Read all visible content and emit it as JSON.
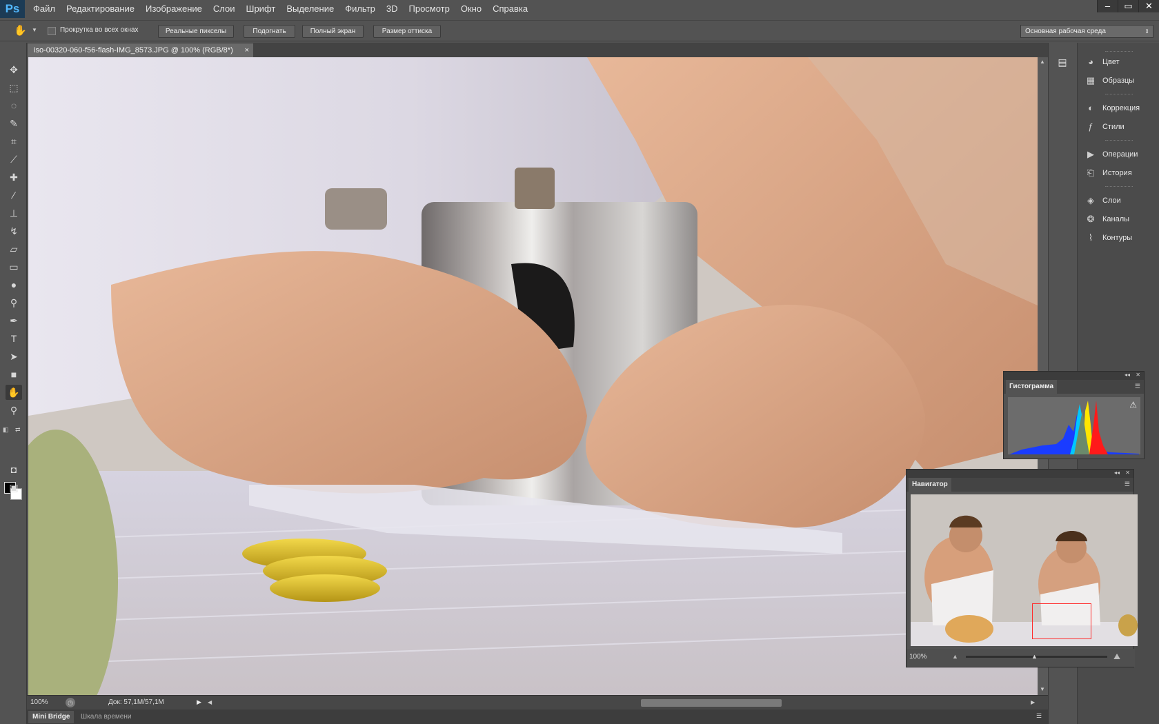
{
  "app": {
    "logo": "Ps"
  },
  "menu": [
    "Файл",
    "Редактирование",
    "Изображение",
    "Слои",
    "Шрифт",
    "Выделение",
    "Фильтр",
    "3D",
    "Просмотр",
    "Окно",
    "Справка"
  ],
  "window_controls": {
    "minimize": "–",
    "restore": "▭",
    "close": "✕"
  },
  "options": {
    "scroll_all_label": "Прокрутка во всех окнах",
    "buttons": [
      "Реальные пикселы",
      "Подогнать",
      "Полный экран",
      "Размер оттиска"
    ],
    "workspace": "Основная рабочая среда"
  },
  "document": {
    "tab_title": "iso-00320-060-f56-flash-IMG_8573.JPG @ 100% (RGB/8*)",
    "close": "×"
  },
  "status": {
    "zoom": "100%",
    "doc_size": "Док: 57,1M/57,1M"
  },
  "bottom_tabs": [
    "Mini Bridge",
    "Шкала времени"
  ],
  "dock": {
    "groups": [
      [
        {
          "label": "Цвет",
          "icon": "color-icon"
        },
        {
          "label": "Образцы",
          "icon": "swatches-icon"
        }
      ],
      [
        {
          "label": "Коррекция",
          "icon": "adjustments-icon"
        },
        {
          "label": "Стили",
          "icon": "styles-icon"
        }
      ],
      [
        {
          "label": "Операции",
          "icon": "actions-icon"
        },
        {
          "label": "История",
          "icon": "history-icon"
        }
      ],
      [
        {
          "label": "Слои",
          "icon": "layers-icon"
        },
        {
          "label": "Каналы",
          "icon": "channels-icon"
        },
        {
          "label": "Контуры",
          "icon": "paths-icon"
        }
      ]
    ]
  },
  "histogram": {
    "title": "Гистограмма",
    "warning": "⚠"
  },
  "navigator": {
    "title": "Навигатор",
    "zoom": "100%"
  },
  "colors": {
    "foreground": "#000000",
    "background": "#ffffff",
    "nav_box": "#ff2a2a"
  }
}
